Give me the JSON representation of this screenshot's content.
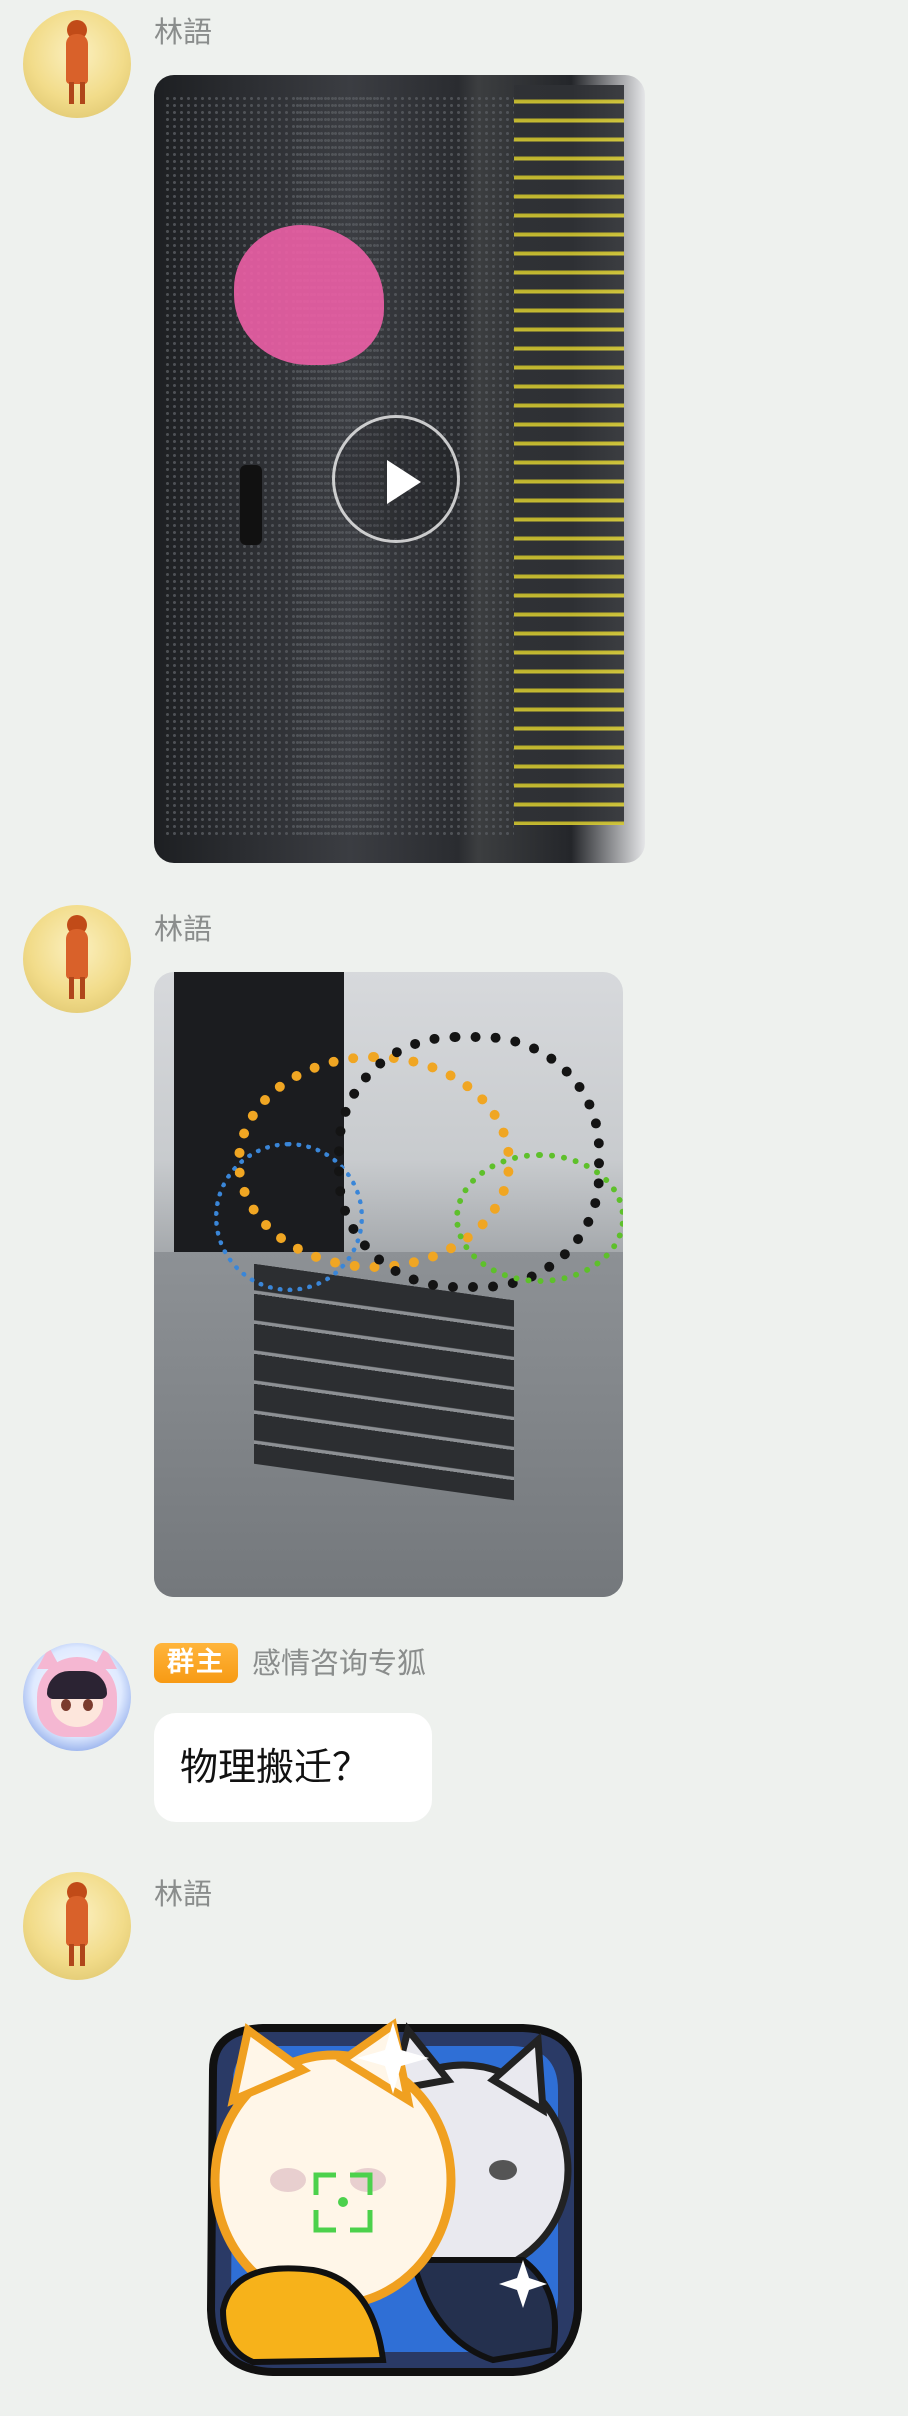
{
  "messages": [
    {
      "sender": "林語",
      "type": "video",
      "avatar": "orange-figure-avatar"
    },
    {
      "sender": "林語",
      "type": "image",
      "avatar": "orange-figure-avatar"
    },
    {
      "sender": "感情咨询专狐",
      "badge": "群主",
      "type": "text",
      "text": "物理搬迁？",
      "avatar": "anime-fox-girl-avatar"
    },
    {
      "sender": "林語",
      "type": "sticker",
      "avatar": "orange-figure-avatar"
    }
  ],
  "colors": {
    "background": "#eef1ee",
    "badge": "#f79a14",
    "bubble": "#ffffff",
    "name": "#8a8d8c"
  }
}
